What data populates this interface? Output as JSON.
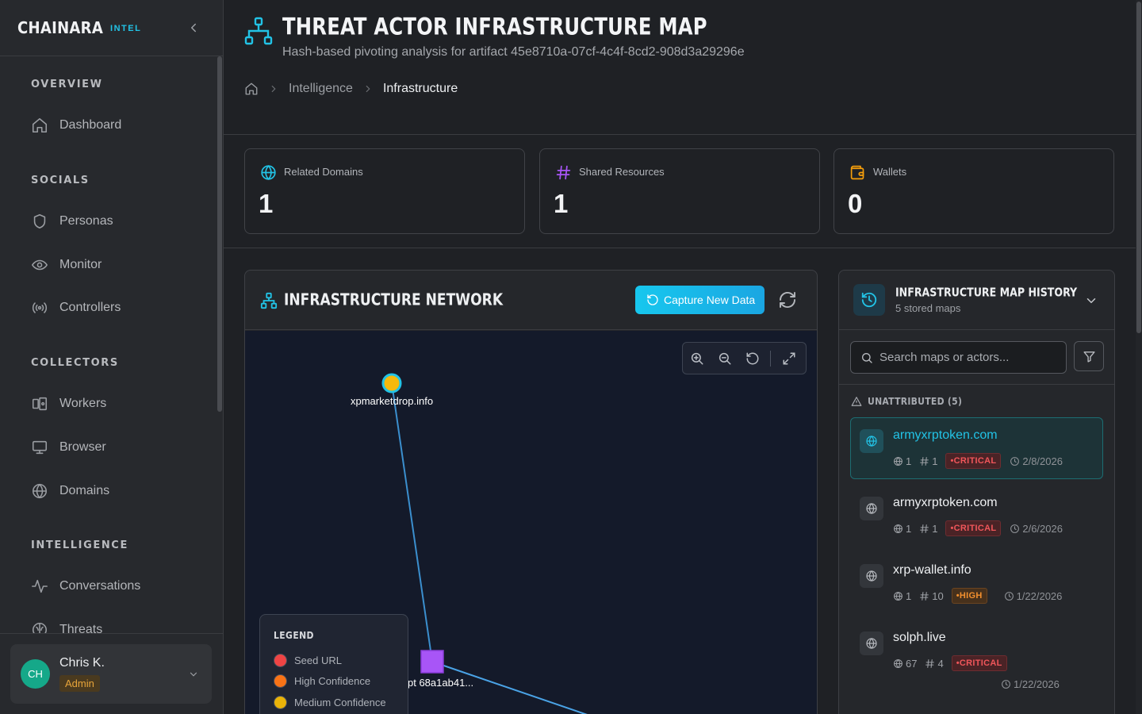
{
  "brand": {
    "name": "CHAINARA",
    "tag": "INTEL"
  },
  "sidebar": {
    "sections": [
      {
        "title": "OVERVIEW",
        "items": [
          {
            "label": "Dashboard",
            "icon": "home-icon"
          }
        ]
      },
      {
        "title": "SOCIALS",
        "items": [
          {
            "label": "Personas",
            "icon": "shield-icon"
          },
          {
            "label": "Monitor",
            "icon": "eye-icon"
          },
          {
            "label": "Controllers",
            "icon": "broadcast-icon"
          }
        ]
      },
      {
        "title": "COLLECTORS",
        "items": [
          {
            "label": "Workers",
            "icon": "worker-icon"
          },
          {
            "label": "Browser",
            "icon": "monitor-icon"
          },
          {
            "label": "Domains",
            "icon": "globe-icon"
          }
        ]
      },
      {
        "title": "INTELLIGENCE",
        "items": [
          {
            "label": "Conversations",
            "icon": "activity-icon"
          },
          {
            "label": "Threats",
            "icon": "brain-icon"
          }
        ]
      }
    ]
  },
  "user": {
    "initials": "CH",
    "name": "Chris K.",
    "role": "Admin"
  },
  "header": {
    "title": "THREAT ACTOR INFRASTRUCTURE MAP",
    "subtitle": "Hash-based pivoting analysis for artifact 45e8710a-07cf-4c4f-8cd2-908d3a29296e",
    "breadcrumbs": [
      "Intelligence",
      "Infrastructure"
    ]
  },
  "stats": [
    {
      "label": "Related Domains",
      "value": "1",
      "icon": "globe-icon",
      "color": "#22c3e6"
    },
    {
      "label": "Shared Resources",
      "value": "1",
      "icon": "hash-icon",
      "color": "#a855f7"
    },
    {
      "label": "Wallets",
      "value": "0",
      "icon": "wallet-icon",
      "color": "#f59e0b"
    }
  ],
  "network": {
    "title": "INFRASTRUCTURE NETWORK",
    "capture_label": "Capture New Data",
    "nodes": [
      {
        "label": "xpmarketdrop.info",
        "type": "domain",
        "color": "#f5b90b"
      },
      {
        "label": "pt 68a1ab41...",
        "type": "shared-resource",
        "color": "#a855f7"
      }
    ],
    "legend": {
      "title": "LEGEND",
      "items": [
        {
          "label": "Seed URL",
          "color": "#ef4444"
        },
        {
          "label": "High Confidence",
          "color": "#f97316"
        },
        {
          "label": "Medium Confidence",
          "color": "#eab308"
        }
      ]
    }
  },
  "history": {
    "title": "INFRASTRUCTURE MAP HISTORY",
    "subtitle": "5 stored maps",
    "search_placeholder": "Search maps or actors...",
    "group_title": "UNATTRIBUTED (5)",
    "items": [
      {
        "domain": "armyxrptoken.com",
        "domains": "1",
        "resources": "1",
        "severity": "CRITICAL",
        "date": "2/8/2026",
        "active": true
      },
      {
        "domain": "armyxrptoken.com",
        "domains": "1",
        "resources": "1",
        "severity": "CRITICAL",
        "date": "2/6/2026",
        "active": false
      },
      {
        "domain": "xrp-wallet.info",
        "domains": "1",
        "resources": "10",
        "severity": "HIGH",
        "date": "1/22/2026",
        "active": false
      },
      {
        "domain": "solph.live",
        "domains": "67",
        "resources": "4",
        "severity": "CRITICAL",
        "date": "1/22/2026",
        "active": false
      }
    ]
  }
}
